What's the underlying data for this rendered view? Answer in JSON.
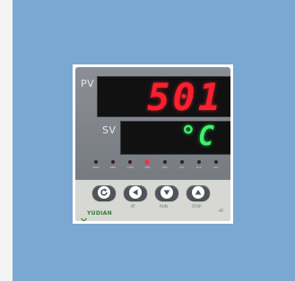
{
  "controller": {
    "pv_label": "PV",
    "pv_value": "501",
    "sv_label": "SV",
    "sv_value": "°C",
    "indicators": [
      {
        "label": "MAN",
        "on": false
      },
      {
        "label": "PRG",
        "on": false
      },
      {
        "label": "COM",
        "on": false
      },
      {
        "label": "OP1",
        "on": true
      },
      {
        "label": "OP2",
        "on": false
      },
      {
        "label": "AL1",
        "on": false
      },
      {
        "label": "AL2",
        "on": false
      },
      {
        "label": "AU1",
        "on": false
      }
    ],
    "keys": [
      {
        "name": "set-key",
        "icon": "cycle-icon"
      },
      {
        "name": "at-key",
        "icon": "left-arrow-icon",
        "label": "AT"
      },
      {
        "name": "run-key",
        "icon": "down-arrow-icon",
        "label": "RUN"
      },
      {
        "name": "stop-key",
        "icon": "up-arrow-icon",
        "label": "STOP"
      }
    ],
    "brand": "YUDIAN",
    "model": "AI"
  },
  "colors": {
    "background_blue": "#7ba8d3",
    "pv_red": "#ff1e2d",
    "sv_green": "#3cf36a",
    "brand_green": "#2e7d32"
  }
}
